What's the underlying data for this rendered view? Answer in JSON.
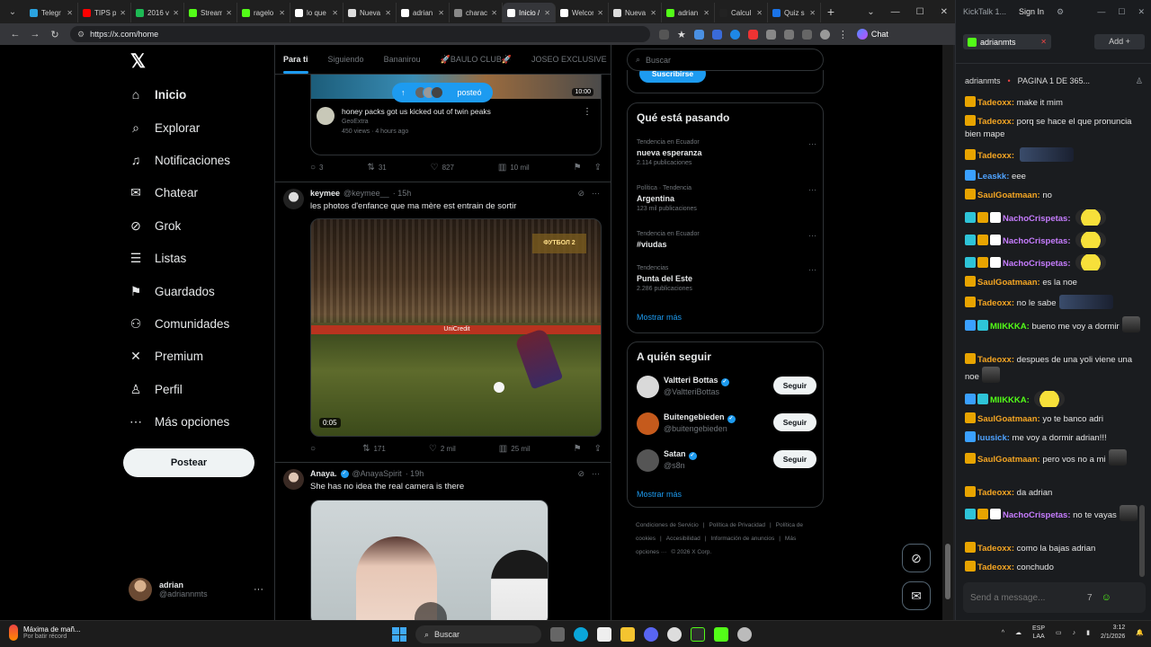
{
  "browser": {
    "tabs": [
      {
        "label": "Telegr",
        "color": "#2aa3e0"
      },
      {
        "label": "TIPS p",
        "color": "#ff0000"
      },
      {
        "label": "2016 v",
        "color": "#1db954"
      },
      {
        "label": "Stream",
        "color": "#53fc18"
      },
      {
        "label": "ragelo",
        "color": "#53fc18"
      },
      {
        "label": "lo que",
        "color": "#ffffff"
      },
      {
        "label": "Nueva",
        "color": "#dddddd"
      },
      {
        "label": "adrian",
        "color": "#ffffff"
      },
      {
        "label": "charac",
        "color": "#888888"
      },
      {
        "label": "Inicio /",
        "color": "#ffffff",
        "active": true
      },
      {
        "label": "Welcor",
        "color": "#ffffff"
      },
      {
        "label": "Nueva",
        "color": "#dddddd"
      },
      {
        "label": "adrian",
        "color": "#53fc18"
      },
      {
        "label": "Calcul",
        "color": "#222222"
      },
      {
        "label": "Quiz s",
        "color": "#1a73e8"
      }
    ],
    "url": "https://x.com/home",
    "chat_label": "Chat"
  },
  "nav": {
    "items": [
      {
        "label": "Inicio",
        "icon": "home-icon",
        "glyph": "⌂"
      },
      {
        "label": "Explorar",
        "icon": "search-icon",
        "glyph": "⌕"
      },
      {
        "label": "Notificaciones",
        "icon": "bell-icon",
        "glyph": "♫"
      },
      {
        "label": "Chatear",
        "icon": "mail-icon",
        "glyph": "✉"
      },
      {
        "label": "Grok",
        "icon": "grok-icon",
        "glyph": "⊘"
      },
      {
        "label": "Listas",
        "icon": "list-icon",
        "glyph": "☰"
      },
      {
        "label": "Guardados",
        "icon": "bookmark-icon",
        "glyph": "⚑"
      },
      {
        "label": "Comunidades",
        "icon": "people-icon",
        "glyph": "⚇"
      },
      {
        "label": "Premium",
        "icon": "x-icon",
        "glyph": "✕"
      },
      {
        "label": "Perfil",
        "icon": "person-icon",
        "glyph": "♙"
      },
      {
        "label": "Más opciones",
        "icon": "more-icon",
        "glyph": "⋯"
      }
    ],
    "post_label": "Postear",
    "account_name": "adrian",
    "account_handle": "@adriannmts"
  },
  "timeline": {
    "tabs": [
      "Para ti",
      "Siguiendo",
      "Bananirou",
      "🚀BAULO CLUB🚀",
      "JOSEO EXCLUSIVE"
    ],
    "posted_label": "posteó",
    "embed": {
      "duration": "10:00",
      "title": "honey packs got us kicked out of twin peaks",
      "channel": "GeoExtra",
      "meta": "450 views · 4 hours ago"
    },
    "post1_actions": {
      "replies": "3",
      "reposts": "31",
      "likes": "827",
      "views": "10 mil"
    },
    "post2": {
      "name": "keymee",
      "handle": "@keymee__",
      "time": "· 15h",
      "text": "les photos d'enfance que ma mère est entrain de sortir",
      "video_duration": "0:05",
      "logo_text": "ФУТБОЛ 2",
      "board_text": "UniCredit",
      "actions": {
        "replies": "",
        "reposts": "171",
        "likes": "2 mil",
        "views": "25 mil"
      }
    },
    "post3": {
      "name": "Anaya.",
      "handle": "@AnayaSpirit",
      "time": "· 19h",
      "text": "She has no idea the real camera is there"
    }
  },
  "sidebar": {
    "search_placeholder": "Buscar",
    "subscribe_label": "Suscribirse",
    "trends_title": "Qué está pasando",
    "trends": [
      {
        "context": "Tendencia en Ecuador",
        "name": "nueva esperanza",
        "count": "2.114 publicaciones"
      },
      {
        "context": "Política · Tendencia",
        "name": "Argentina",
        "count": "123 mil publicaciones"
      },
      {
        "context": "Tendencia en Ecuador",
        "name": "#viudas",
        "count": ""
      },
      {
        "context": "Tendencias",
        "name": "Punta del Este",
        "count": "2.286 publicaciones"
      }
    ],
    "show_more": "Mostrar más",
    "who_title": "A quién seguir",
    "who": [
      {
        "name": "Valtteri Bottas",
        "handle": "@ValtteriBottas",
        "color": "#d9d9d9"
      },
      {
        "name": "Buitengebieden",
        "handle": "@buitengebieden",
        "color": "#c55a1c"
      },
      {
        "name": "Satan",
        "handle": "@s8n",
        "color": "#555555"
      }
    ],
    "follow_label": "Seguir",
    "show_more_2": "Mostrar más",
    "footer": [
      "Condiciones de Servicio",
      "|",
      "Política de Privacidad",
      "|",
      "Política de cookies",
      "|",
      "Accesibilidad",
      "|",
      "Información de anuncios",
      "|",
      "Más opciones ···",
      "© 2026 X Corp."
    ]
  },
  "kick": {
    "app": "KickTalk 1...",
    "sign_in": "Sign In",
    "tab_label": "adrianmts",
    "add_label": "Add",
    "channel": "adrianmts",
    "page": "PAGINA 1 DE 365...",
    "messages": [
      {
        "user": "Tadeoxx:",
        "text": "make it mim",
        "color": "#f5a623"
      },
      {
        "user": "Tadeoxx:",
        "text": "porq se hace el que pronuncia bien mape",
        "color": "#f5a623"
      },
      {
        "user": "Tadeoxx:",
        "text": "",
        "color": "#f5a623",
        "emote": "wide"
      },
      {
        "user": "Leaskk:",
        "text": "eee",
        "color": "#4fa3ff"
      },
      {
        "user": "SaulGoatmaan:",
        "text": "no",
        "color": "#f5a623"
      },
      {
        "user": "NachoCrispetas:",
        "text": "",
        "color": "#c77dff",
        "emote": "yellow"
      },
      {
        "user": "NachoCrispetas:",
        "text": "",
        "color": "#c77dff",
        "emote": "yellow"
      },
      {
        "user": "NachoCrispetas:",
        "text": "",
        "color": "#c77dff",
        "emote": "yellow"
      },
      {
        "user": "SaulGoatmaan:",
        "text": "es la noe",
        "color": "#f5a623"
      },
      {
        "user": "Tadeoxx:",
        "text": "no le sabe",
        "color": "#f5a623",
        "emote": "wide"
      },
      {
        "user": "MIIKKKA:",
        "text": "bueno me voy a dormir",
        "color": "#53fc18",
        "emote": "small"
      },
      {
        "user": "Tadeoxx:",
        "text": "despues de una yoli viene una noe",
        "color": "#f5a623",
        "emote": "small"
      },
      {
        "user": "MIIKKKA:",
        "text": "",
        "color": "#53fc18",
        "emote": "yellow"
      },
      {
        "user": "SaulGoatmaan:",
        "text": "yo te banco adri",
        "color": "#f5a623"
      },
      {
        "user": "luusick:",
        "text": "me voy a dormir adrian!!!",
        "color": "#4fa3ff"
      },
      {
        "user": "SaulGoatmaan:",
        "text": "pero vos no a mi",
        "color": "#f5a623",
        "emote": "small"
      },
      {
        "user": "Tadeoxx:",
        "text": "da adrian",
        "color": "#f5a623"
      },
      {
        "user": "NachoCrispetas:",
        "text": "no te vayas",
        "color": "#c77dff",
        "emote": "small"
      },
      {
        "user": "Tadeoxx:",
        "text": "como la bajas adrian",
        "color": "#f5a623"
      },
      {
        "user": "Tadeoxx:",
        "text": "conchudo",
        "color": "#f5a623"
      }
    ],
    "send_placeholder": "Send a message..."
  },
  "taskbar": {
    "weather_title": "Máxima de mañ...",
    "weather_sub": "Por batir récord",
    "search_label": "Buscar",
    "lang1": "ESP",
    "lang2": "LAA",
    "time": "3:12",
    "date": "2/1/2026"
  }
}
